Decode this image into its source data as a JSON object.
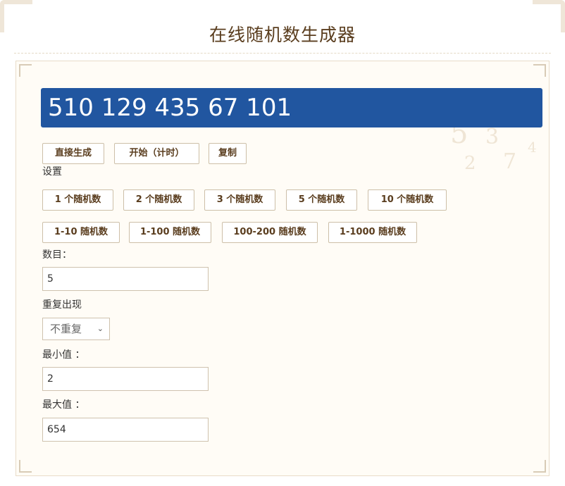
{
  "header": {
    "title": "在线随机数生成器"
  },
  "result": {
    "value": "510 129 435 67 101"
  },
  "actions": {
    "generate": "直接生成",
    "start_timed": "开始（计时）",
    "copy": "复制"
  },
  "settings": {
    "label": "设置",
    "count_presets": [
      "1 个随机数",
      "2 个随机数",
      "3 个随机数",
      "5 个随机数",
      "10 个随机数"
    ],
    "range_presets": [
      "1-10 随机数",
      "1-100 随机数",
      "100-200 随机数",
      "1-1000 随机数"
    ]
  },
  "form": {
    "count_label": "数目：",
    "count_value": "5",
    "repeat_label": "重复出现",
    "repeat_value": "不重复",
    "min_label": "最小值 ：",
    "min_value": "2",
    "max_label": "最大值 ：",
    "max_value": "654"
  }
}
